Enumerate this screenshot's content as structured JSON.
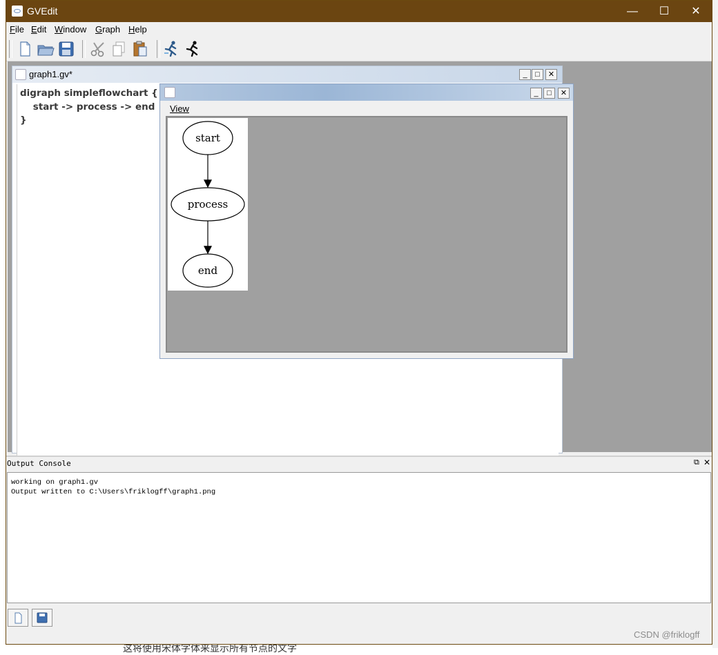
{
  "app": {
    "title": "GVEdit",
    "window_controls": {
      "minimize": "—",
      "maximize": "☐",
      "close": "✕"
    }
  },
  "menu": [
    {
      "label": "File",
      "mnemonic": "F",
      "rest": "ile"
    },
    {
      "label": "Edit",
      "mnemonic": "E",
      "rest": "dit"
    },
    {
      "label": "Window",
      "mnemonic": "W",
      "rest": "indow"
    },
    {
      "label": "Graph",
      "mnemonic": "G",
      "rest": "raph"
    },
    {
      "label": "Help",
      "mnemonic": "H",
      "rest": "elp"
    }
  ],
  "toolbar": {
    "buttons": [
      "new-file-icon",
      "open-folder-icon",
      "save-disk-icon",
      "cut-scissors-icon",
      "copy-pages-icon",
      "paste-clipboard-icon",
      "layout-runner-icon",
      "run-runner-icon"
    ]
  },
  "editor_window": {
    "title": "graph1.gv*",
    "code_lines": [
      "digraph simpleflowchart {",
      "    start -> process -> end",
      "}"
    ]
  },
  "graph_window": {
    "menu_view": "View",
    "nodes": [
      "start",
      "process",
      "end"
    ]
  },
  "console": {
    "title": "Output Console",
    "lines": [
      "working on graph1.gv",
      "Output written to C:\\Users\\friklogff\\graph1.png"
    ]
  },
  "colors": {
    "titlebar": "#6b4511",
    "mdi_background": "#a0a0a0",
    "subwindow_title": "#b4c8e0"
  },
  "watermark": "CSDN @friklogff",
  "background_text": "这将使用宋体字体来显示所有节点的文字"
}
